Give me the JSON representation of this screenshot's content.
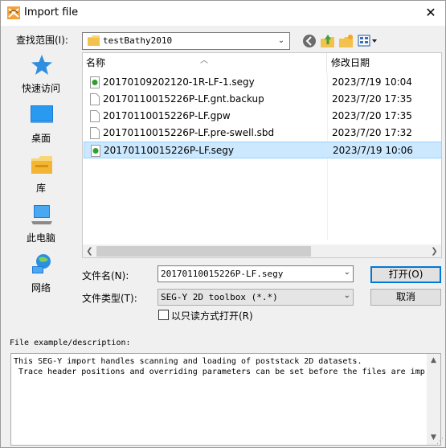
{
  "window": {
    "title": "Import file"
  },
  "lookin": {
    "label": "查找范围(I):",
    "value": "testBathy2010"
  },
  "places": [
    {
      "label": "快速访问",
      "icon": "star-icon"
    },
    {
      "label": "桌面",
      "icon": "desktop-icon"
    },
    {
      "label": "库",
      "icon": "library-icon"
    },
    {
      "label": "此电脑",
      "icon": "computer-icon"
    },
    {
      "label": "网络",
      "icon": "network-icon"
    }
  ],
  "filelist": {
    "col_name": "名称",
    "col_date": "修改日期",
    "rows": [
      {
        "name": "20170109202120-1R-LF-1.segy",
        "date": "2023/7/19 10:04",
        "icon": "segy-file-icon",
        "selected": false
      },
      {
        "name": "20170110015226P-LF.gnt.backup",
        "date": "2023/7/20 17:35",
        "icon": "file-icon",
        "selected": false
      },
      {
        "name": "20170110015226P-LF.gpw",
        "date": "2023/7/20 17:35",
        "icon": "file-icon",
        "selected": false
      },
      {
        "name": "20170110015226P-LF.pre-swell.sbd",
        "date": "2023/7/20 17:32",
        "icon": "file-icon",
        "selected": false
      },
      {
        "name": "20170110015226P-LF.segy",
        "date": "2023/7/19 10:06",
        "icon": "segy-file-icon",
        "selected": true
      }
    ]
  },
  "filename": {
    "label": "文件名(N):",
    "value": "20170110015226P-LF.segy"
  },
  "filetype": {
    "label": "文件类型(T):",
    "value": "SEG-Y 2D toolbox (*.*)"
  },
  "readonly": {
    "label": "以只读方式打开(R)",
    "checked": false
  },
  "buttons": {
    "open": "打开(O)",
    "cancel": "取消"
  },
  "description": {
    "label": "File example/description:",
    "line1": "This SEG-Y import handles scanning and loading of poststack 2D datasets.",
    "line2": " Trace header positions and overriding parameters can be set before the files are imp"
  },
  "colors": {
    "accent": "#0078d7",
    "selection": "#cce8ff",
    "folder": "#f8d775"
  }
}
